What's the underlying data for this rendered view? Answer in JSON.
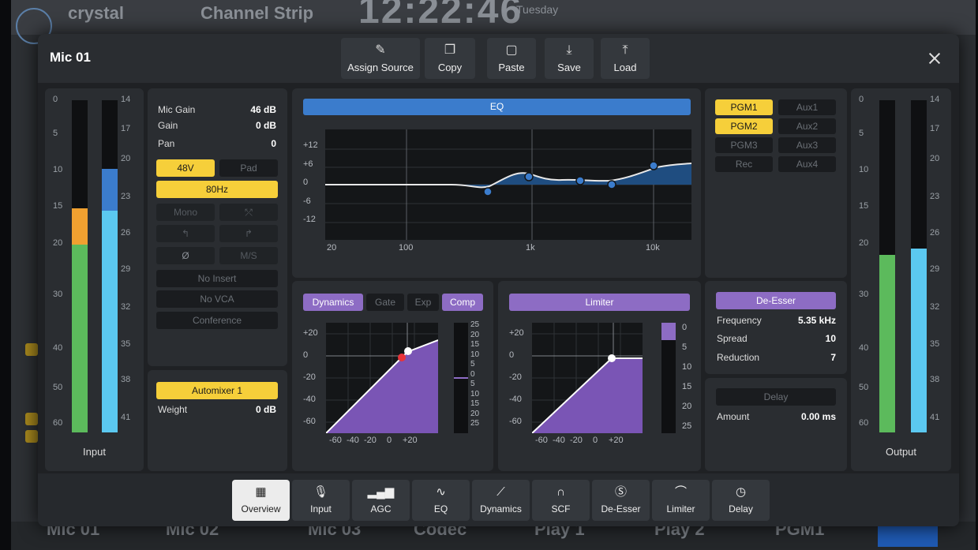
{
  "background": {
    "brand": "crystal",
    "title": "Channel Strip",
    "clock": "12:22:46",
    "day": "Tuesday",
    "channels": [
      "Mic 01",
      "Mic 02",
      "Mic 03",
      "Codec",
      "Play 1",
      "Play 2",
      "PGM1"
    ]
  },
  "dialog": {
    "title": "Mic 01",
    "toolbar": [
      {
        "label": "Assign Source",
        "icon": "pencil-icon"
      },
      {
        "label": "Copy",
        "icon": "copy-icon"
      },
      {
        "label": "Paste",
        "icon": "paste-icon"
      },
      {
        "label": "Save",
        "icon": "save-icon"
      },
      {
        "label": "Load",
        "icon": "load-icon"
      }
    ]
  },
  "input_meter": {
    "label": "Input",
    "scale_left": [
      "0",
      "5",
      "10",
      "15",
      "20",
      "30",
      "40",
      "50",
      "60"
    ],
    "scale_right": [
      "14",
      "17",
      "20",
      "23",
      "26",
      "29",
      "32",
      "35",
      "38",
      "41"
    ]
  },
  "output_meter": {
    "label": "Output",
    "scale_left": [
      "0",
      "5",
      "10",
      "15",
      "20",
      "30",
      "40",
      "50",
      "60"
    ],
    "scale_right": [
      "14",
      "17",
      "20",
      "23",
      "26",
      "29",
      "32",
      "35",
      "38",
      "41"
    ]
  },
  "input_panel": {
    "mic_gain_label": "Mic Gain",
    "mic_gain_value": "46 dB",
    "gain_label": "Gain",
    "gain_value": "0 dB",
    "pan_label": "Pan",
    "pan_value": "0",
    "phantom": "48V",
    "pad": "Pad",
    "hpf": "80Hz",
    "mono": "Mono",
    "phase": "Ø",
    "ms": "M/S",
    "no_insert": "No Insert",
    "no_vca": "No VCA",
    "conference": "Conference"
  },
  "automixer": {
    "label": "Automixer 1",
    "weight_label": "Weight",
    "weight_value": "0 dB"
  },
  "eq": {
    "title": "EQ",
    "y_ticks": [
      "+12",
      "+6",
      "0",
      "-6",
      "-12"
    ],
    "x_ticks": [
      "20",
      "100",
      "1k",
      "10k"
    ]
  },
  "routing": {
    "left": [
      "PGM1",
      "PGM2",
      "PGM3",
      "Rec"
    ],
    "right": [
      "Aux1",
      "Aux2",
      "Aux3",
      "Aux4"
    ],
    "active": [
      "PGM1",
      "PGM2"
    ]
  },
  "dynamics": {
    "tabs": [
      "Dynamics",
      "Gate",
      "Exp",
      "Comp"
    ],
    "y_ticks": [
      "+20",
      "0",
      "-20",
      "-40",
      "-60"
    ],
    "x_ticks": [
      "-60",
      "-40",
      "-20",
      "0",
      "+20"
    ],
    "meter_ticks": [
      "25",
      "20",
      "15",
      "10",
      "5",
      "0",
      "5",
      "10",
      "15",
      "20",
      "25"
    ]
  },
  "limiter": {
    "title": "Limiter",
    "y_ticks": [
      "+20",
      "0",
      "-20",
      "-40",
      "-60"
    ],
    "x_ticks": [
      "-60",
      "-40",
      "-20",
      "0",
      "+20"
    ],
    "meter_ticks": [
      "0",
      "5",
      "10",
      "15",
      "20",
      "25"
    ]
  },
  "deesser": {
    "title": "De-Esser",
    "frequency_label": "Frequency",
    "frequency_value": "5.35 kHz",
    "spread_label": "Spread",
    "spread_value": "10",
    "reduction_label": "Reduction",
    "reduction_value": "7"
  },
  "delay": {
    "title": "Delay",
    "amount_label": "Amount",
    "amount_value": "0.00 ms"
  },
  "tabs": [
    {
      "label": "Overview",
      "icon": "grid-icon"
    },
    {
      "label": "Input",
      "icon": "microphone-icon"
    },
    {
      "label": "AGC",
      "icon": "bars-icon"
    },
    {
      "label": "EQ",
      "icon": "eq-curve-icon"
    },
    {
      "label": "Dynamics",
      "icon": "dynamics-curve-icon"
    },
    {
      "label": "SCF",
      "icon": "filter-curve-icon"
    },
    {
      "label": "De-Esser",
      "icon": "deesser-icon"
    },
    {
      "label": "Limiter",
      "icon": "limiter-curve-icon"
    },
    {
      "label": "Delay",
      "icon": "clock-icon"
    }
  ],
  "active_tab": "Overview",
  "colors": {
    "accent_yellow": "#f6cf3a",
    "accent_purple": "#8d6cc4",
    "accent_blue": "#3b7ccc",
    "meter_green": "#5cba5c",
    "meter_cyan": "#5bc8f0",
    "meter_orange": "#f0a030"
  }
}
